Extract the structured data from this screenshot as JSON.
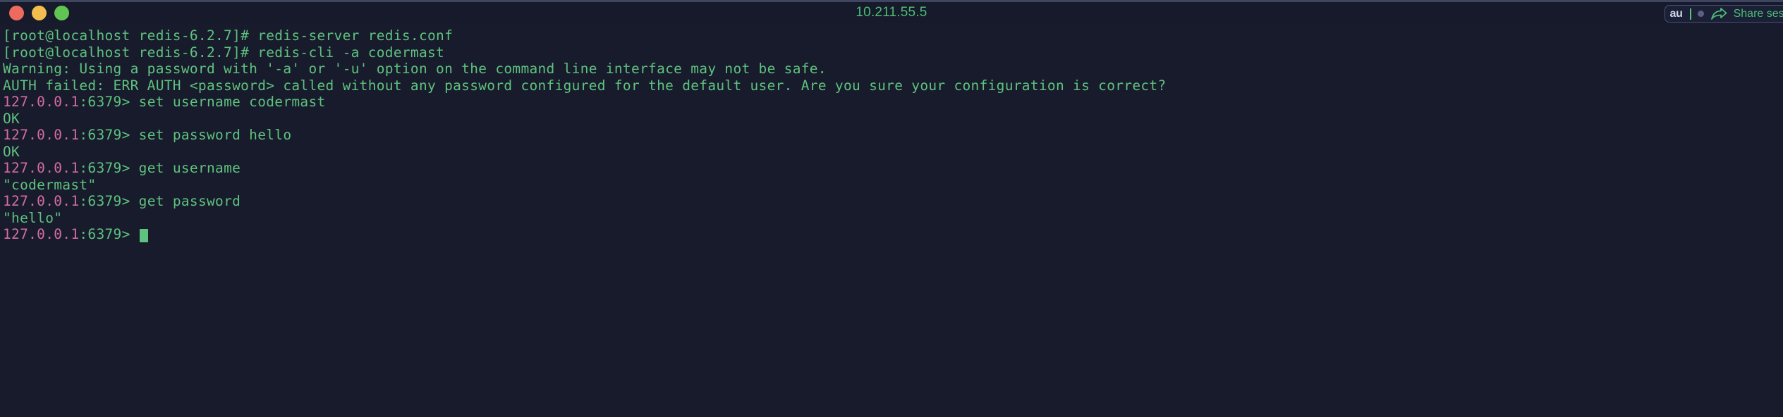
{
  "window": {
    "title": "10.211.55.5",
    "traffic_lights": [
      {
        "name": "close",
        "color": "#ec6a5e"
      },
      {
        "name": "minimize",
        "color": "#f4bd4f"
      },
      {
        "name": "maximize",
        "color": "#61c554"
      }
    ]
  },
  "titlebar_right": {
    "input_value": "au",
    "share_icon": "share-arrow-icon",
    "share_label": "Share session"
  },
  "colors": {
    "background": "#171b2c",
    "titlebar": "#161a2b",
    "prompt_green": "#5fc27e",
    "prompt_pink": "#d46ba5",
    "output_white": "#d8dce8",
    "cursor": "#5fc27e"
  },
  "terminal": {
    "lines": [
      {
        "id": 1,
        "text": "[root@localhost redis-6.2.7]# redis-server redis.conf"
      },
      {
        "id": 2,
        "text": "[root@localhost redis-6.2.7]# redis-cli -a codermast"
      },
      {
        "id": 3,
        "text": "Warning: Using a password with '-a' or '-u' option on the command line interface may not be safe."
      },
      {
        "id": 4,
        "text": "AUTH failed: ERR AUTH <password> called without any password configured for the default user. Are you sure your configuration is correct?"
      },
      {
        "id": 5,
        "prompt_host": "127.0.0.1",
        "prompt_port": ":6379>",
        "command": " set username codermast"
      },
      {
        "id": 6,
        "text": "OK"
      },
      {
        "id": 7,
        "prompt_host": "127.0.0.1",
        "prompt_port": ":6379>",
        "command": " set password hello"
      },
      {
        "id": 8,
        "text": "OK"
      },
      {
        "id": 9,
        "prompt_host": "127.0.0.1",
        "prompt_port": ":6379>",
        "command": " get username"
      },
      {
        "id": 10,
        "text": "\"codermast\""
      },
      {
        "id": 11,
        "prompt_host": "127.0.0.1",
        "prompt_port": ":6379>",
        "command": " get password"
      },
      {
        "id": 12,
        "text": "\"hello\""
      },
      {
        "id": 13,
        "prompt_host": "127.0.0.1",
        "prompt_port": ":6379>",
        "command": " ",
        "cursor": true
      }
    ]
  }
}
